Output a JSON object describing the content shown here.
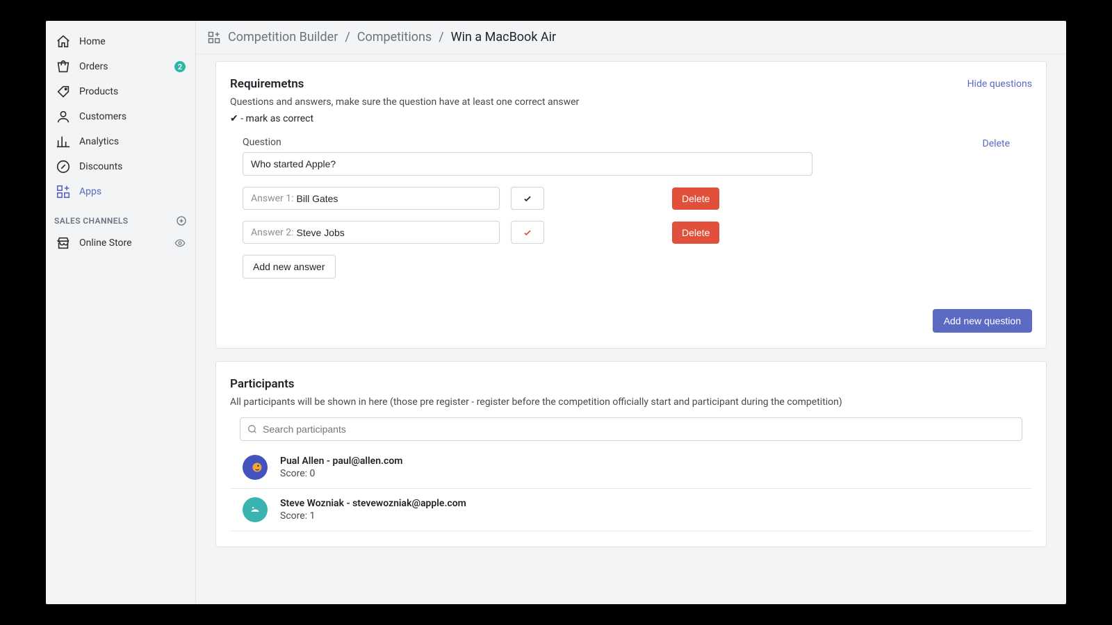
{
  "breadcrumb": {
    "root": "Competition Builder",
    "section": "Competitions",
    "current": "Win a MacBook Air"
  },
  "sidebar": {
    "items": [
      {
        "label": "Home"
      },
      {
        "label": "Orders",
        "badge": "2"
      },
      {
        "label": "Products"
      },
      {
        "label": "Customers"
      },
      {
        "label": "Analytics"
      },
      {
        "label": "Discounts"
      },
      {
        "label": "Apps"
      }
    ],
    "channelsTitle": "SALES CHANNELS",
    "channels": [
      {
        "label": "Online Store"
      }
    ]
  },
  "requirements": {
    "title": "Requiremetns",
    "hideLabel": "Hide questions",
    "desc": "Questions and answers, make sure the question have at least one correct answer",
    "hint": "✔ - mark as correct",
    "questionLabel": "Question",
    "deleteQuestionLabel": "Delete",
    "questionValue": "Who started Apple?",
    "answers": [
      {
        "prefix": "Answer 1:",
        "value": "Bill Gates",
        "correct": false
      },
      {
        "prefix": "Answer 2:",
        "value": "Steve Jobs",
        "correct": true
      }
    ],
    "deleteAnswerLabel": "Delete",
    "addAnswerLabel": "Add new answer",
    "addQuestionLabel": "Add new question"
  },
  "participants": {
    "title": "Participants",
    "desc": "All participants will be shown in here (those pre register - register before the competition officially start and participant during the competition)",
    "searchPlaceholder": "Search participants",
    "list": [
      {
        "heading": "Pual Allen - paul@allen.com",
        "scoreLine": "Score: 0"
      },
      {
        "heading": "Steve Wozniak - stevewozniak@apple.com",
        "scoreLine": "Score: 1"
      }
    ]
  }
}
